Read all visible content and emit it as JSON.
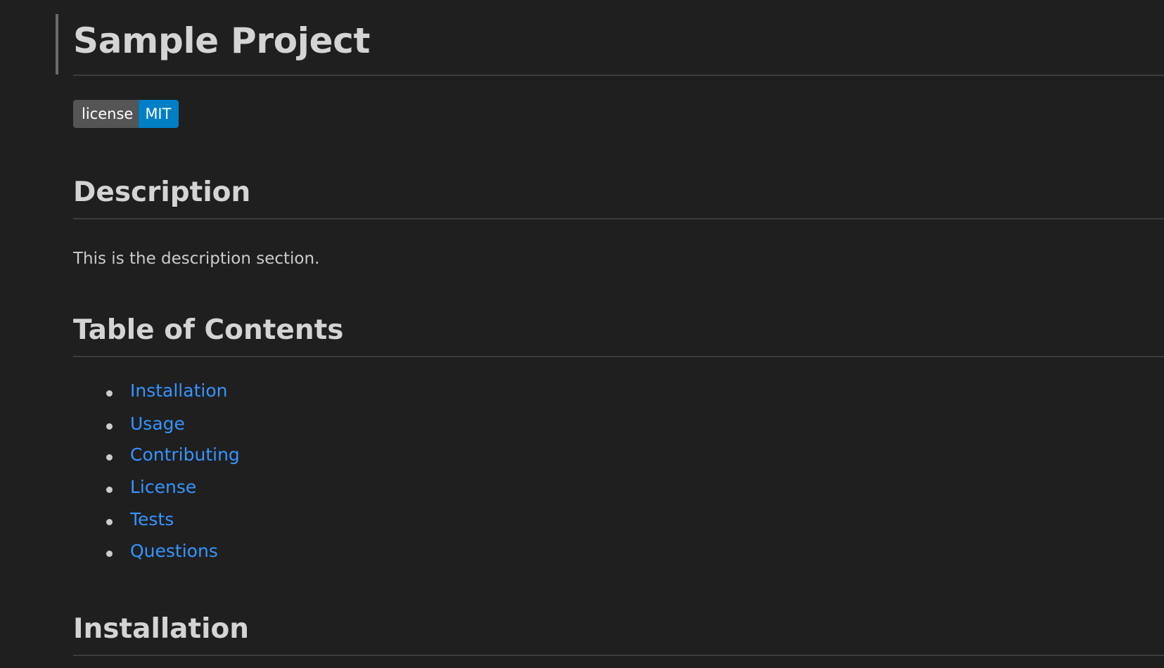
{
  "document": {
    "title": "Sample Project",
    "badge": {
      "label": "license",
      "value": "MIT",
      "label_color": "#555555",
      "value_color": "#007ec6"
    },
    "sections": [
      {
        "heading": "Description",
        "body": "This is the description section."
      },
      {
        "heading": "Table of Contents"
      },
      {
        "heading": "Installation"
      }
    ],
    "toc": [
      "Installation",
      "Usage",
      "Contributing",
      "License",
      "Tests",
      "Questions"
    ]
  },
  "theme": {
    "background": "#1f1f1f",
    "text": "#cccccc",
    "link": "#3794ff",
    "rule": "#3c3c3c"
  }
}
